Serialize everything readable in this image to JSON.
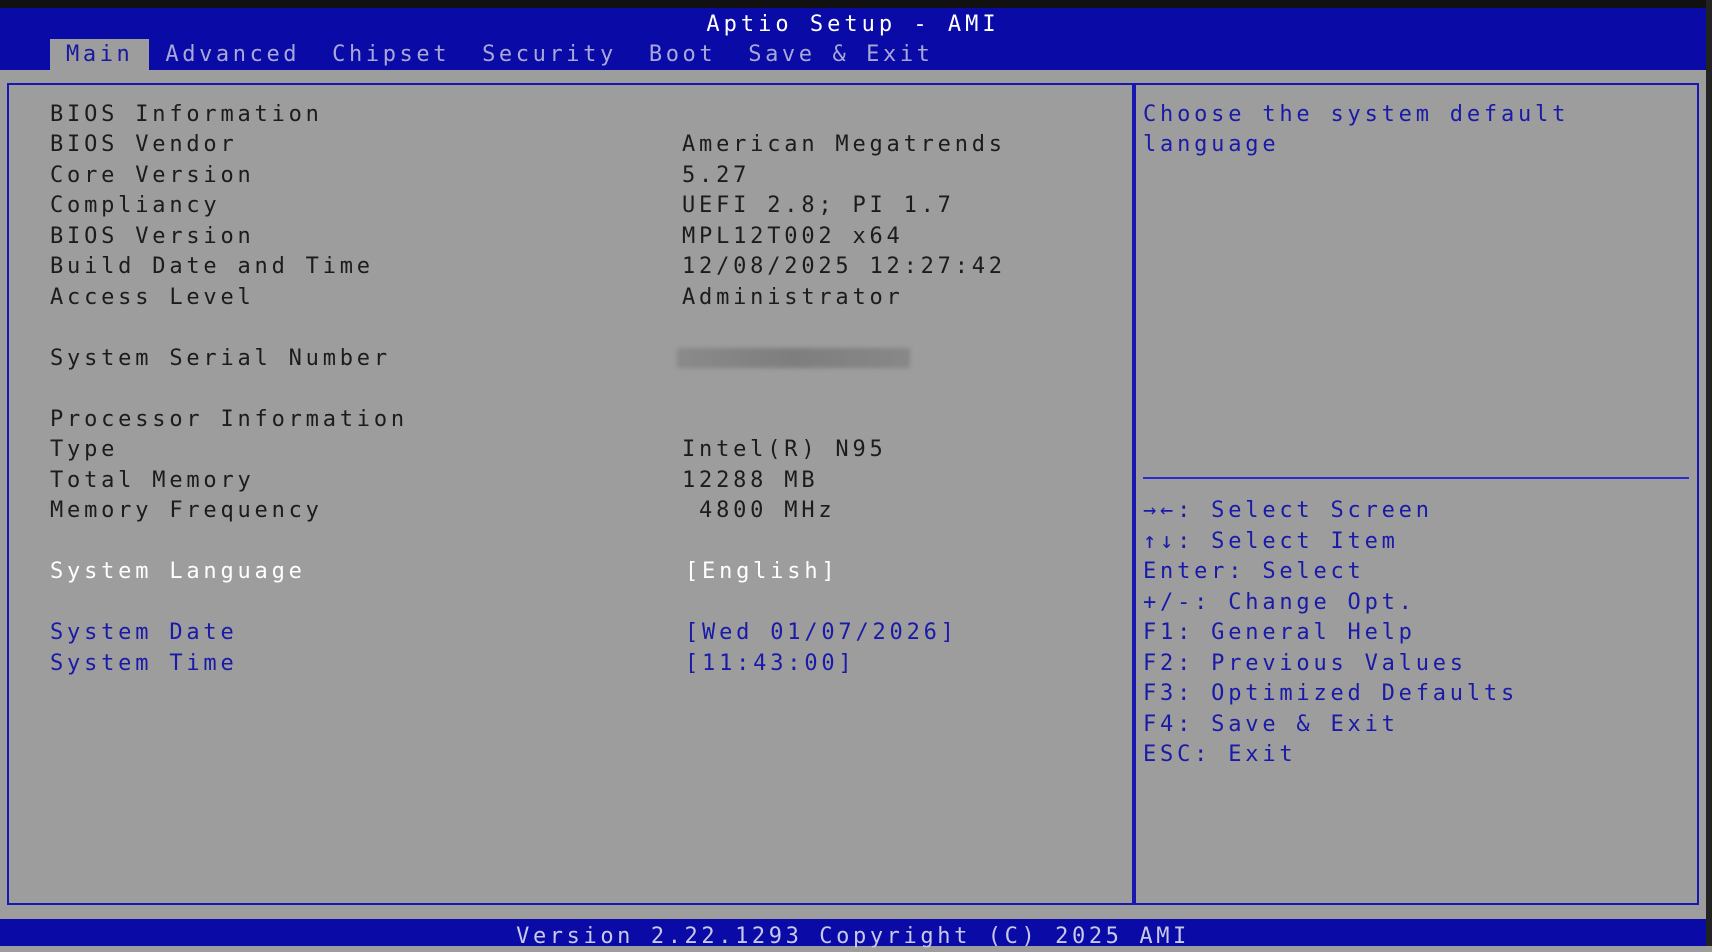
{
  "header": {
    "title": "Aptio Setup - AMI"
  },
  "tabs": [
    {
      "label": "Main",
      "active": true
    },
    {
      "label": "Advanced"
    },
    {
      "label": "Chipset"
    },
    {
      "label": "Security"
    },
    {
      "label": "Boot"
    },
    {
      "label": "Save & Exit"
    }
  ],
  "main": {
    "bios_info_heading": "BIOS Information",
    "bios_vendor": {
      "label": "BIOS Vendor",
      "value": "American Megatrends"
    },
    "core_version": {
      "label": "Core Version",
      "value": "5.27"
    },
    "compliancy": {
      "label": "Compliancy",
      "value": "UEFI 2.8; PI 1.7"
    },
    "bios_version": {
      "label": "BIOS Version",
      "value": "MPL12T002 x64"
    },
    "build_date": {
      "label": "Build Date and Time",
      "value": "12/08/2025 12:27:42"
    },
    "access_level": {
      "label": "Access Level",
      "value": "Administrator"
    },
    "serial": {
      "label": "System Serial Number"
    },
    "processor_heading": "Processor Information",
    "type": {
      "label": "Type",
      "value": "Intel(R) N95"
    },
    "total_memory": {
      "label": "Total Memory",
      "value": "12288 MB"
    },
    "memory_frequency": {
      "label": "Memory Frequency",
      "value": " 4800 MHz"
    },
    "system_language": {
      "label": "System Language",
      "value": "[English]"
    },
    "system_date": {
      "label": "System Date",
      "value": "[Wed 01/07/2026]"
    },
    "system_time": {
      "label": "System Time",
      "value": "[11:43:00]"
    }
  },
  "help": {
    "description": [
      "Choose the system default",
      "language"
    ],
    "keys": [
      "→←: Select Screen",
      "↑↓: Select Item",
      "Enter: Select",
      "+/-: Change Opt.",
      "F1: General Help",
      "F2: Previous Values",
      "F3: Optimized Defaults",
      "F4: Save & Exit",
      "ESC: Exit"
    ]
  },
  "footer": {
    "text": "Version 2.22.1293 Copyright (C) 2025 AMI"
  }
}
